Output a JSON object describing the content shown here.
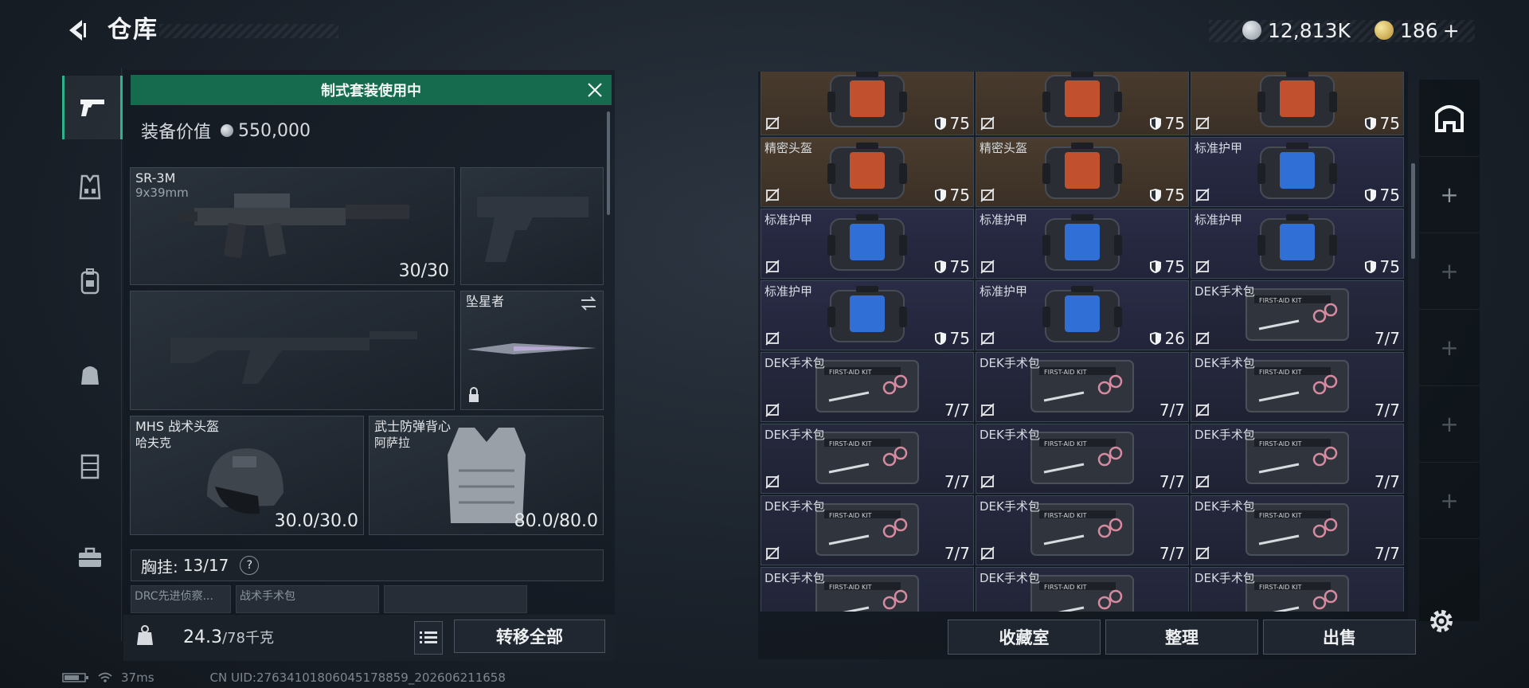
{
  "header": {
    "title": "仓库"
  },
  "currency": [
    {
      "icon": "silver-coin-icon",
      "value": "12,813K"
    },
    {
      "icon": "gold-coin-icon",
      "value": "186",
      "add": "+"
    }
  ],
  "nav": [
    {
      "icon": "pistol-icon",
      "active": true
    },
    {
      "icon": "chest-rig-icon"
    },
    {
      "icon": "backpack-icon"
    },
    {
      "icon": "bag-icon"
    },
    {
      "icon": "locker-icon"
    },
    {
      "icon": "toolbox-icon"
    }
  ],
  "loadout": {
    "banner": "制式套装使用中",
    "value_label": "装备价值",
    "value": "550,000",
    "primary": {
      "name": "SR-3M",
      "ammo": "9x39mm",
      "count": "30/30"
    },
    "melee": {
      "name": "坠星者"
    },
    "helmet": {
      "name": "MHS 战术头盔",
      "sub": "哈夫克",
      "durability": "30.0/30.0"
    },
    "vest": {
      "name": "武士防弹背心",
      "sub": "阿萨拉",
      "durability": "80.0/80.0"
    },
    "chest_rig": {
      "label": "胸挂:",
      "count": "13/17",
      "help": "?"
    },
    "mini_slots": [
      "DRC先进侦察...",
      "战术手术包",
      ""
    ],
    "weight": "24.3",
    "weight_max": "/78千克",
    "transfer_all": "转移全部"
  },
  "inventory": {
    "rows": [
      [
        {
          "name": "",
          "type": "helmet",
          "value": "75"
        },
        {
          "name": "",
          "type": "helmet",
          "value": "75"
        },
        {
          "name": "",
          "type": "helmet",
          "value": "75"
        }
      ],
      [
        {
          "name": "精密头盔",
          "type": "helmet",
          "value": "75"
        },
        {
          "name": "精密头盔",
          "type": "helmet",
          "value": "75"
        },
        {
          "name": "标准护甲",
          "type": "armor",
          "value": "75"
        }
      ],
      [
        {
          "name": "标准护甲",
          "type": "armor",
          "value": "75"
        },
        {
          "name": "标准护甲",
          "type": "armor",
          "value": "75"
        },
        {
          "name": "标准护甲",
          "type": "armor",
          "value": "75"
        }
      ],
      [
        {
          "name": "标准护甲",
          "type": "armor",
          "value": "75"
        },
        {
          "name": "标准护甲",
          "type": "armor",
          "value": "26"
        },
        {
          "name": "DEK手术包",
          "type": "kit",
          "value": "7/7"
        }
      ],
      [
        {
          "name": "DEK手术包",
          "type": "kit",
          "value": "7/7"
        },
        {
          "name": "DEK手术包",
          "type": "kit",
          "value": "7/7"
        },
        {
          "name": "DEK手术包",
          "type": "kit",
          "value": "7/7"
        }
      ],
      [
        {
          "name": "DEK手术包",
          "type": "kit",
          "value": "7/7"
        },
        {
          "name": "DEK手术包",
          "type": "kit",
          "value": "7/7"
        },
        {
          "name": "DEK手术包",
          "type": "kit",
          "value": "7/7"
        }
      ],
      [
        {
          "name": "DEK手术包",
          "type": "kit",
          "value": "7/7"
        },
        {
          "name": "DEK手术包",
          "type": "kit",
          "value": "7/7"
        },
        {
          "name": "DEK手术包",
          "type": "kit",
          "value": "7/7"
        }
      ],
      [
        {
          "name": "DEK手术包",
          "type": "kit",
          "value": ""
        },
        {
          "name": "DEK手术包",
          "type": "kit",
          "value": ""
        },
        {
          "name": "DEK手术包",
          "type": "kit",
          "value": ""
        }
      ]
    ],
    "kit_label": "FIRST-AID KIT",
    "buttons": {
      "collection": "收藏室",
      "sort": "整理",
      "sell": "出售"
    }
  },
  "right_tabs": [
    "stash-icon",
    "+",
    "+",
    "+",
    "+",
    "+"
  ],
  "status": {
    "ping": "37ms",
    "uid": "CN UID:27634101806045178859_202606211658"
  },
  "colors": {
    "accent_green": "#166b4e",
    "helmet_bg": "#4a3c2e",
    "armor_bg": "#2a2c46"
  }
}
